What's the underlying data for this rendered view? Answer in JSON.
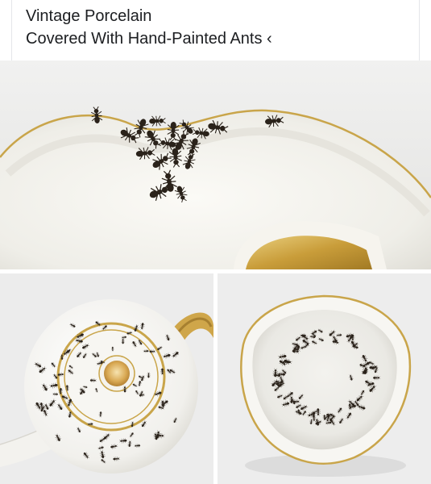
{
  "post": {
    "title_line_1": "Vintage Porcelain",
    "title_line_2": "Covered With Hand-Painted Ants ‹"
  },
  "photos": [
    {
      "subject": "porcelain-jug-with-ants"
    },
    {
      "subject": "teapot-with-ants"
    },
    {
      "subject": "bowl-with-ant-ring"
    }
  ],
  "colors": {
    "title_text": "#1c1e21",
    "porcelain": "#f4f3ef",
    "gold_trim": "#c9a54a",
    "ant": "#2a221a",
    "backdrop": "#ececec"
  }
}
